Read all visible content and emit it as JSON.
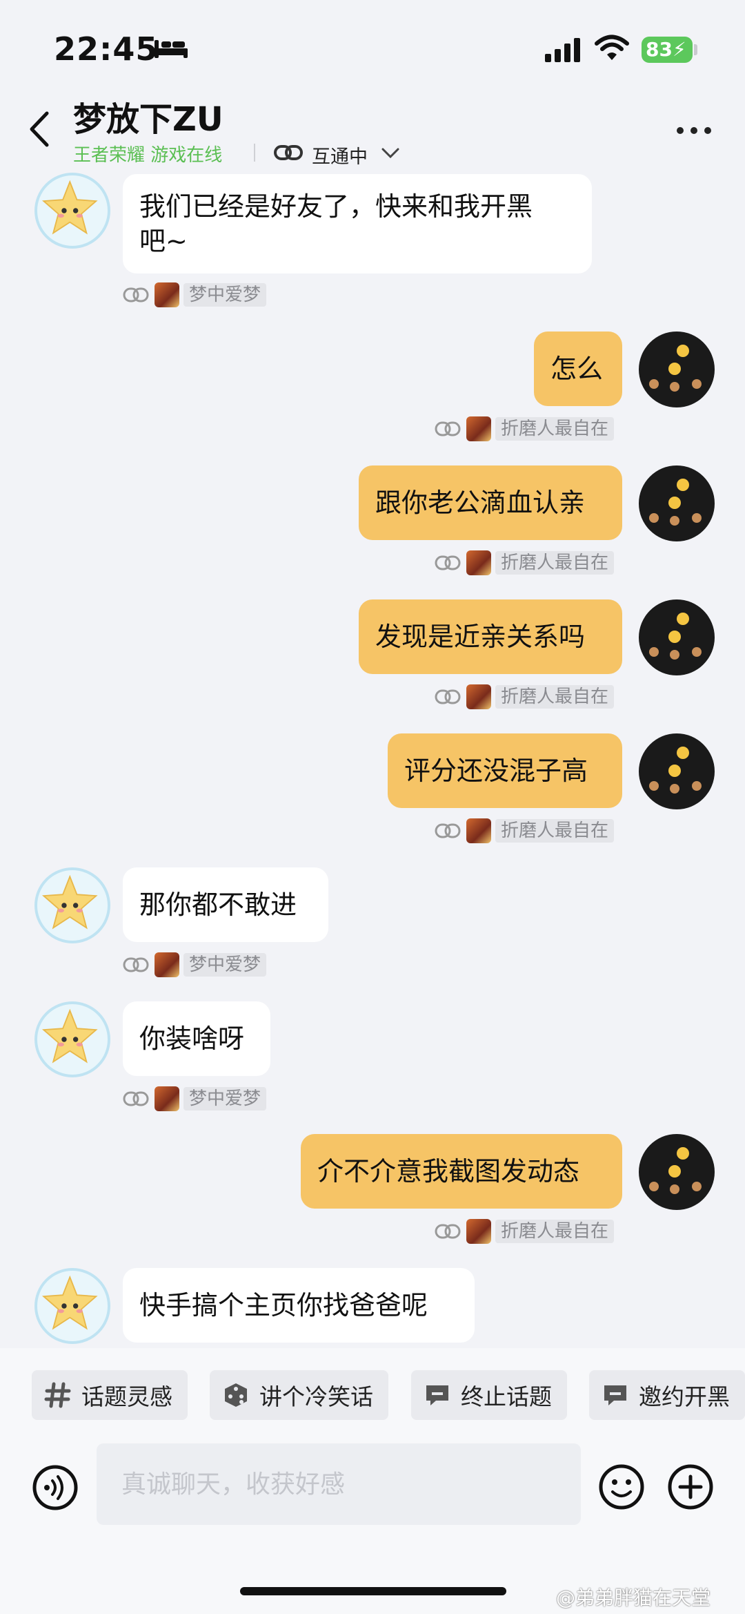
{
  "status_bar": {
    "time": "22:45",
    "battery": "83"
  },
  "header": {
    "name": "梦放下ZU",
    "game_status": "王者荣耀 游戏在线",
    "link_state": "互通中"
  },
  "messages": [
    {
      "side": "left",
      "lines": [
        "我们已经是好友了，快来和我开黑",
        "吧~"
      ],
      "tag": "梦中爱梦"
    },
    {
      "side": "right",
      "lines": [
        "怎么"
      ],
      "tag": "折磨人最自在"
    },
    {
      "side": "right",
      "lines": [
        "跟你老公滴血认亲"
      ],
      "tag": "折磨人最自在"
    },
    {
      "side": "right",
      "lines": [
        "发现是近亲关系吗"
      ],
      "tag": "折磨人最自在"
    },
    {
      "side": "right",
      "lines": [
        "评分还没混子高"
      ],
      "tag": "折磨人最自在"
    },
    {
      "side": "left",
      "lines": [
        "那你都不敢进"
      ],
      "tag": "梦中爱梦"
    },
    {
      "side": "left",
      "lines": [
        "你装啥呀"
      ],
      "tag": "梦中爱梦"
    },
    {
      "side": "right",
      "lines": [
        "介不介意我截图发动态"
      ],
      "tag": "折磨人最自在"
    },
    {
      "side": "left",
      "lines": [
        "快手搞个主页你找爸爸呢"
      ],
      "tag": ""
    }
  ],
  "chips": [
    "话题灵感",
    "讲个冷笑话",
    "终止话题",
    "邀约开黑"
  ],
  "input": {
    "placeholder": "真诚聊天，收获好感",
    "value": ""
  },
  "watermark": "@弟弟胖猫在天堂",
  "colors": {
    "accent_green": "#5bbf53",
    "outgoing_bubble": "#f6c466",
    "incoming_bubble": "#ffffff",
    "battery": "#5cc85c"
  }
}
